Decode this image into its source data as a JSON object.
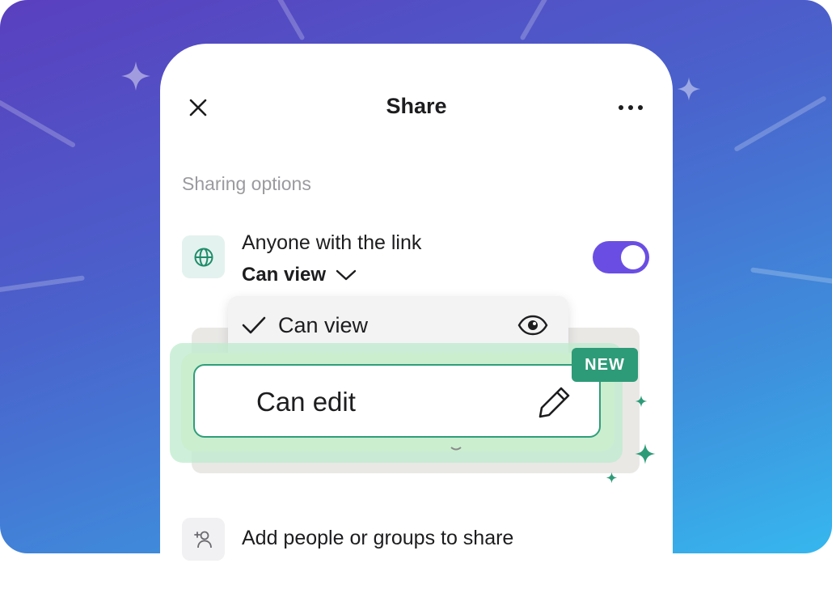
{
  "header": {
    "title": "Share"
  },
  "sharing": {
    "section_label": "Sharing options",
    "link_title": "Anyone with the link",
    "permission_label": "Can view",
    "toggle_on": true
  },
  "dropdown": {
    "items": [
      {
        "label": "Can view",
        "selected": true,
        "icon": "eye-icon"
      },
      {
        "label": "Can edit",
        "selected": false,
        "icon": "pencil-icon",
        "badge": "NEW"
      }
    ]
  },
  "people": {
    "label": "Add people or groups to share"
  },
  "colors": {
    "accent": "#6a4ee3",
    "green": "#2e9b78",
    "bg_start": "#5a3fbe",
    "bg_end": "#36b7ee"
  }
}
